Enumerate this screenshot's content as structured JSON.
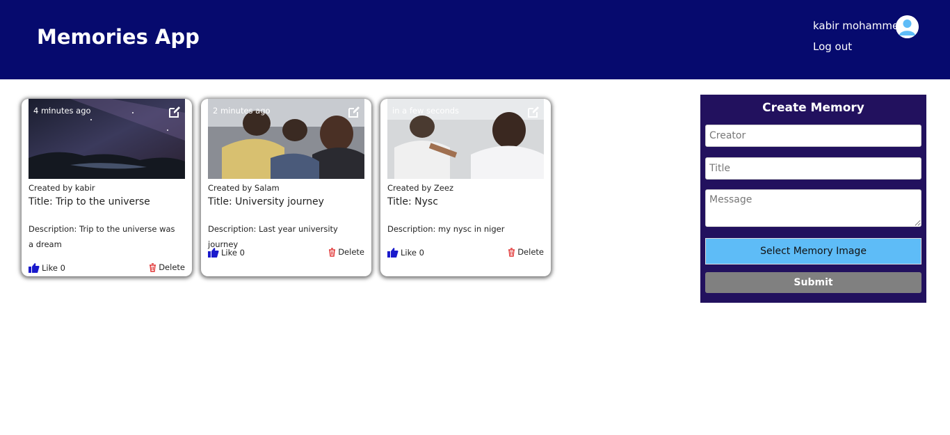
{
  "header": {
    "app_title": "Memories App",
    "user_name": "kabir mohammed",
    "logout_label": "Log out"
  },
  "posts": [
    {
      "time": "4 minutes ago",
      "created_by": "Created by kabir",
      "title": "Title: Trip to the universe",
      "description": "Description: Trip to the universe was a dream",
      "like_label": "Like 0",
      "delete_label": "Delete"
    },
    {
      "time": "2 minutes ago",
      "created_by": "Created by Salam",
      "title": "Title: University journey",
      "description": "Description: Last year university journey",
      "like_label": "Like 0",
      "delete_label": "Delete"
    },
    {
      "time": "in a few seconds",
      "created_by": "Created by Zeez",
      "title": "Title: Nysc",
      "description": "Description: my nysc in niger",
      "like_label": "Like 0",
      "delete_label": "Delete"
    }
  ],
  "form": {
    "title": "Create Memory",
    "creator_placeholder": "Creator",
    "title_placeholder": "Title",
    "message_placeholder": "Message",
    "select_image_label": "Select Memory Image",
    "submit_label": "Submit"
  },
  "colors": {
    "header_bg": "#060a6e",
    "form_bg": "#22115e",
    "select_image_bg": "#5ebcf7",
    "submit_bg": "#808080",
    "like_icon": "#1a1acc",
    "delete_icon": "#e03030"
  },
  "icons": {
    "avatar": "user-avatar-icon",
    "edit": "edit-icon",
    "like": "thumbs-up-icon",
    "delete": "trash-icon"
  }
}
